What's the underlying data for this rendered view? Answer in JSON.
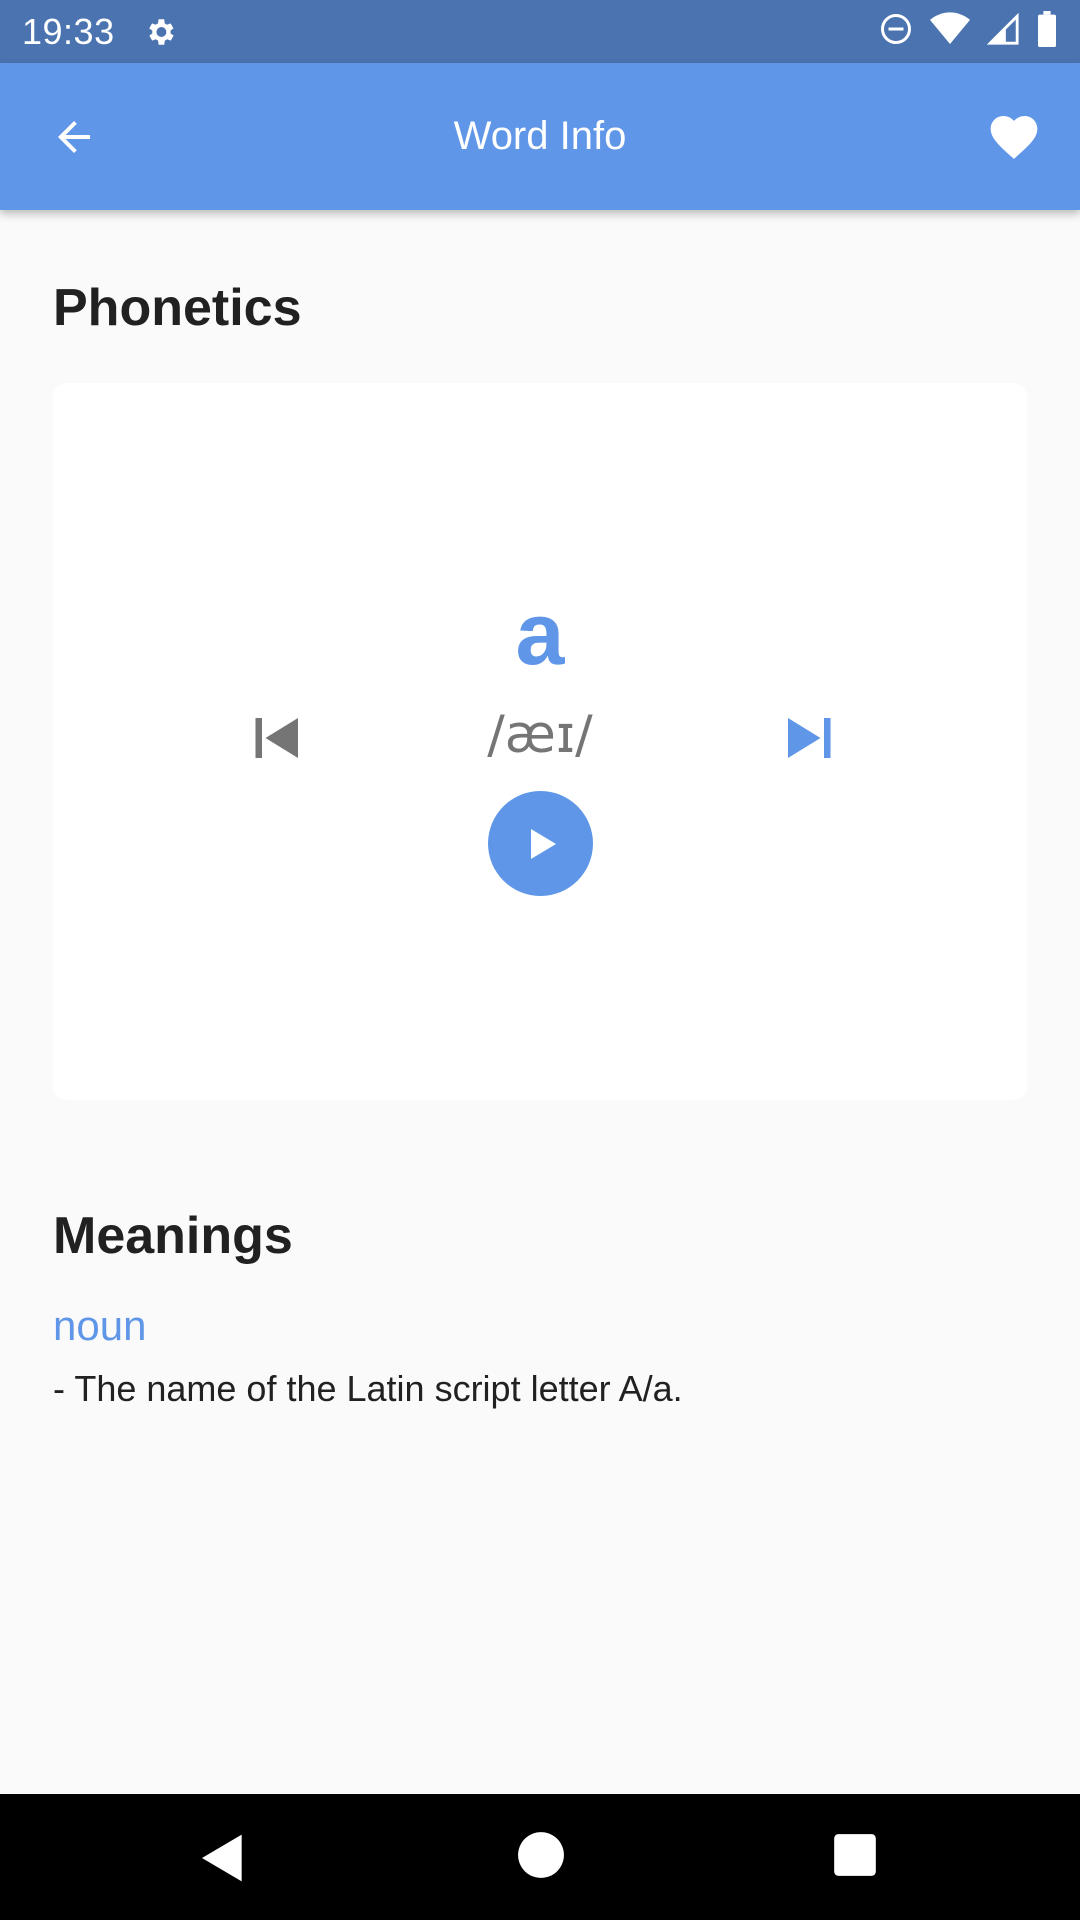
{
  "status_bar": {
    "time": "19:33",
    "icons": [
      "gear-icon",
      "dnd-icon",
      "wifi-icon",
      "signal-icon",
      "battery-icon"
    ]
  },
  "app_bar": {
    "title": "Word Info",
    "back_icon": "arrow-back-icon",
    "favorite_icon": "heart-icon"
  },
  "phonetics": {
    "title": "Phonetics",
    "word": "a",
    "transcription": "/æɪ/",
    "prev_icon": "skip-previous-icon",
    "next_icon": "skip-next-icon",
    "play_icon": "play-icon"
  },
  "meanings": {
    "title": "Meanings",
    "items": [
      {
        "part_of_speech": "noun",
        "definition": "- The name of the Latin script letter A/a."
      }
    ]
  },
  "nav_bar": {
    "icons": [
      "nav-back-icon",
      "nav-home-icon",
      "nav-recents-icon"
    ]
  },
  "colors": {
    "status_bar": "#4a73b0",
    "app_bar": "#5f96e8",
    "accent": "#5f96e8",
    "disabled_control": "#757575",
    "background": "#fafafa",
    "card": "#ffffff",
    "text_primary": "#212121"
  }
}
